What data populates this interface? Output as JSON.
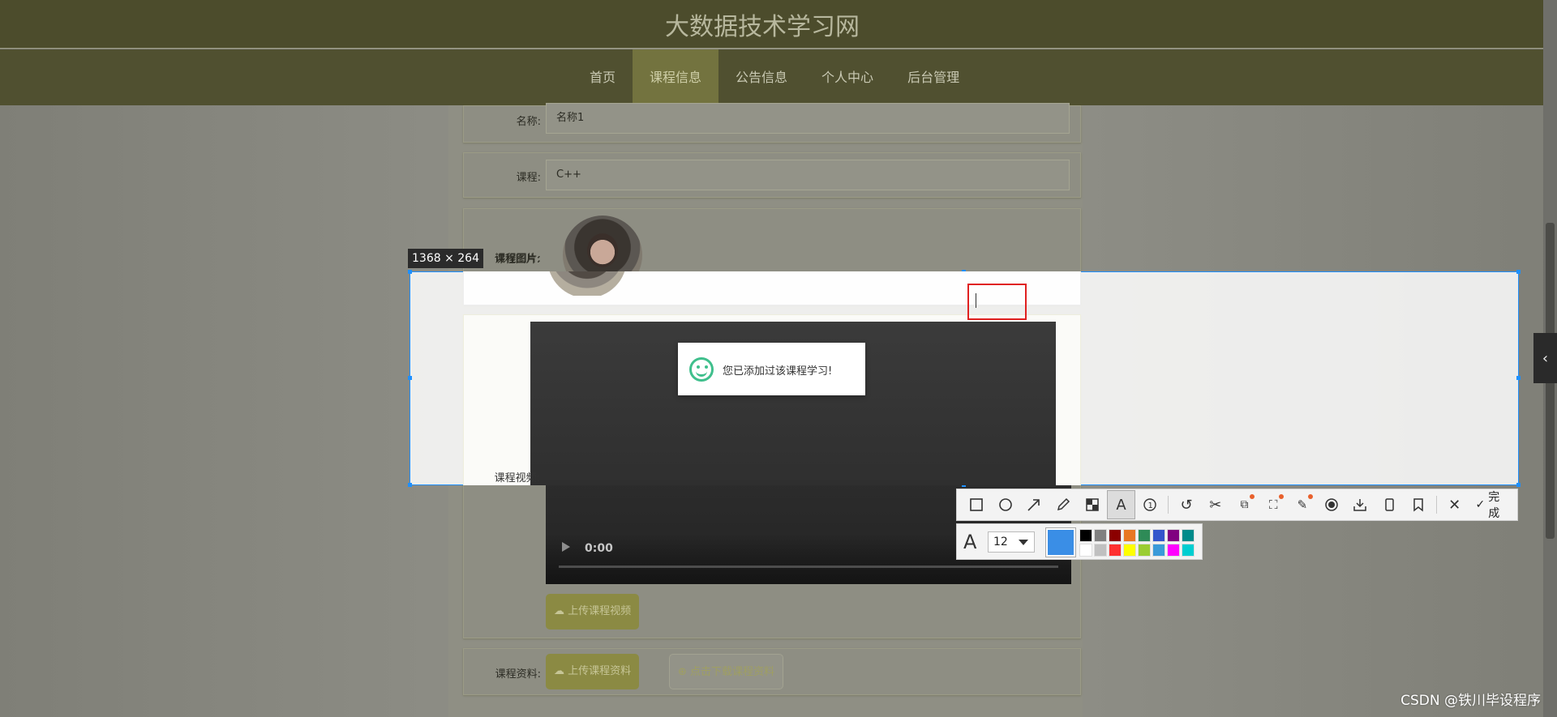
{
  "site": {
    "title": "大数据技术学习网",
    "nav": [
      {
        "label": "首页",
        "active": false
      },
      {
        "label": "课程信息",
        "active": true
      },
      {
        "label": "公告信息",
        "active": false
      },
      {
        "label": "个人中心",
        "active": false
      },
      {
        "label": "后台管理",
        "active": false
      }
    ]
  },
  "form": {
    "name_label": "名称:",
    "name_value": "名称1",
    "course_label": "课程:",
    "course_value": "C++",
    "image_label": "课程图片:",
    "video_label": "课程视频:",
    "video_time": "0:00",
    "upload_video_label": "上传课程视频",
    "material_label": "课程资料:",
    "upload_material_label": "上传课程资料",
    "download_material_label": "点击下载课程资料"
  },
  "toast": {
    "message": "您已添加过该课程学习!",
    "icon": "smile-icon",
    "color": "#3fbf8c"
  },
  "capture": {
    "size_label": "1368 × 264",
    "selection_color": "#1e90ff",
    "text_box_color": "#e02020",
    "toolbar_icons": [
      "rectangle-icon",
      "ellipse-icon",
      "arrow-icon",
      "pencil-icon",
      "mosaic-icon",
      "text-icon",
      "number-icon",
      "undo-icon",
      "cut-icon",
      "ocr-icon",
      "scroll-capture-icon",
      "pin-icon",
      "record-icon",
      "download-icon",
      "phone-icon",
      "bookmark-icon",
      "close-icon"
    ],
    "done_label": "完成",
    "font_size": "12",
    "current_color": "#3a8ee6",
    "palette": [
      "#000000",
      "#808080",
      "#8b0000",
      "#e87722",
      "#2e8b57",
      "#3355cc",
      "#800080",
      "#008b8b",
      "#ffffff",
      "#c0c0c0",
      "#ff3030",
      "#ffff00",
      "#9acd32",
      "#3a9ad9",
      "#ff00ff",
      "#00ced1"
    ]
  },
  "watermark": "CSDN @铁川毕设程序"
}
